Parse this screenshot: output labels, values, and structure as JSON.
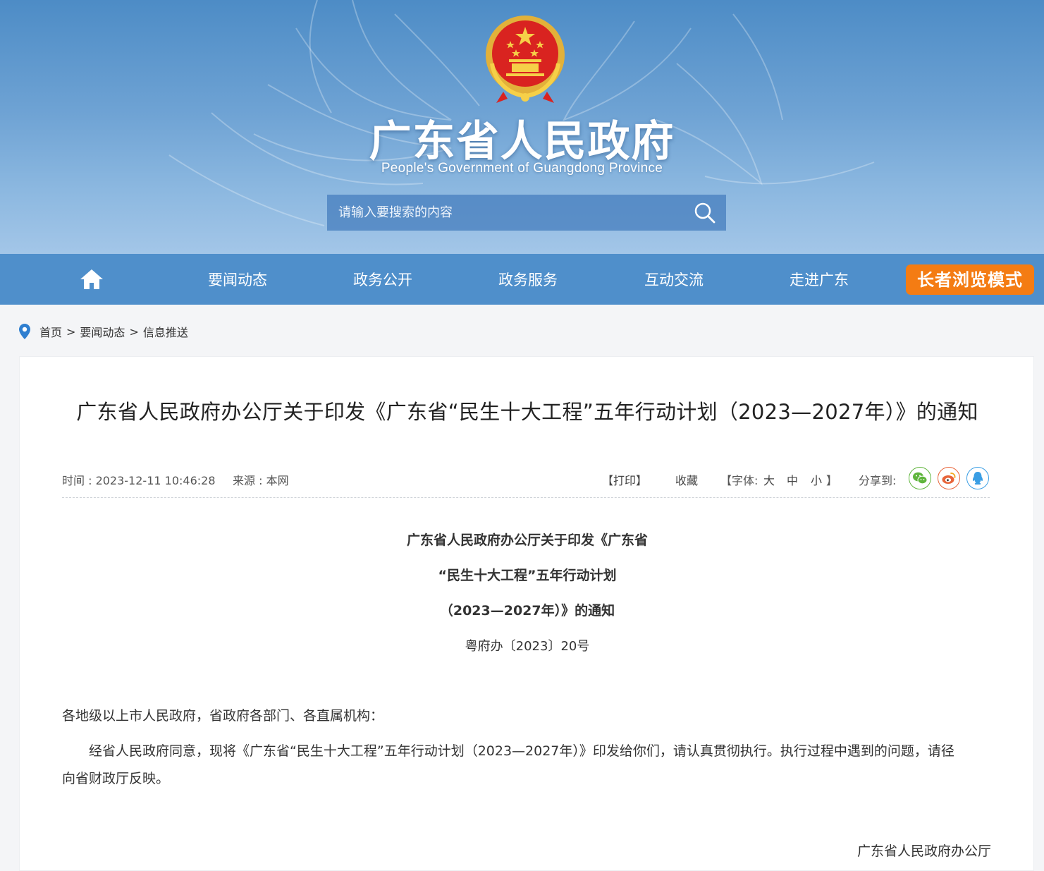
{
  "header": {
    "site_title": "广东省人民政府",
    "site_subtitle": "People's Government of Guangdong Province",
    "search_placeholder": "请输入要搜索的内容"
  },
  "nav": {
    "items": [
      "要闻动态",
      "政务公开",
      "政务服务",
      "互动交流",
      "走进广东"
    ],
    "elder_mode": "长者浏览模式"
  },
  "breadcrumb": {
    "items": [
      "首页",
      "要闻动态",
      "信息推送"
    ],
    "separator": ">"
  },
  "article": {
    "title": "广东省人民政府办公厅关于印发《广东省“民生十大工程”五年行动计划（2023—2027年）》的通知",
    "meta": {
      "time": "时间 : 2023-12-11 10:46:28",
      "source": "来源 : 本网",
      "print": "【打印】",
      "favorite": "收藏",
      "font_label": "【字体:",
      "font_large": "大",
      "font_medium": "中",
      "font_small": "小",
      "font_close": "】",
      "share_label": "分享到:"
    },
    "doc_heading_lines": [
      "广东省人民政府办公厅关于印发《广东省",
      "“民生十大工程”五年行动计划",
      "（2023—2027年）》的通知"
    ],
    "doc_number": "粤府办〔2023〕20号",
    "salutation": "各地级以上市人民政府，省政府各部门、各直属机构：",
    "body_line1": "经省人民政府同意，现将《广东省“民生十大工程”五年行动计划（2023—2027年）》印发给你们，请认真贯彻执行。执行过程中遇到的问题，请径",
    "body_line2": "向省财政厅反映。",
    "signature": "广东省人民政府办公厅"
  },
  "colors": {
    "nav_bg": "#4f8fcb",
    "elder_button": "#f47c13",
    "wechat": "#5fb53c",
    "weibo": "#e8653a",
    "qq": "#3a9ee4"
  }
}
